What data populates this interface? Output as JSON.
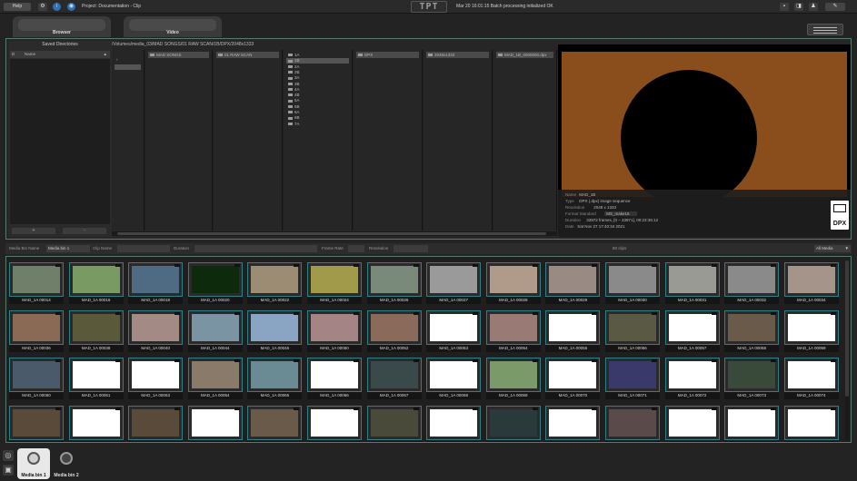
{
  "topbar": {
    "help_label": "Help",
    "project_title": "Project: Documentation - Clip",
    "logo_text": "TPT",
    "status_message": "Mar 20 16:01:15 Batch processing initialized OK"
  },
  "tabs": [
    {
      "label": "Browser"
    },
    {
      "label": "Video"
    }
  ],
  "browser": {
    "saved_title": "Saved Directories",
    "col_number": "D",
    "col_name": "Name",
    "sort_icon": "▲",
    "btn_add": "+",
    "btn_remove": "-",
    "path": "/Volumes/media_03/MAD SONGS/01 RAW SCAN/1B/DPX/2048x1333",
    "columns": [
      {
        "selected": "",
        "items": []
      },
      {
        "selected": "MAD SONGS",
        "items": []
      },
      {
        "selected": "01 RAW SCAN",
        "items": []
      },
      {
        "selected": "",
        "items": [
          "1A",
          "1B",
          "2A",
          "2B",
          "3A",
          "3B",
          "4A",
          "4B",
          "5A",
          "5B",
          "6A",
          "6B",
          "7A"
        ],
        "active_index": 1
      },
      {
        "selected": "DPX",
        "items": []
      },
      {
        "selected": "2048x1333",
        "items": []
      },
      {
        "selected": "MAD_1B_0000000.dpx",
        "items": []
      }
    ]
  },
  "preview_info": {
    "name_k": "Name",
    "name_v": "MAD_1B",
    "type_k": "Type",
    "type_v": "DPX (.dpx) image sequence",
    "res_k": "Resolution",
    "res_v": "2048 x 1333",
    "fmt_k": "Format Standard",
    "fmt_v": "MS_make16",
    "dur_k": "Duration",
    "dur_v": "33972 frames, [0 – 33971], 00:23:35:12",
    "date_k": "Date",
    "date_v": "Sat Nov 27 17:40:34 2021",
    "badge": "DPX"
  },
  "filter": {
    "bin_name_label": "Media Bin Name",
    "bin_name_value": "Media bin 1",
    "clip_name_label": "Clip Name",
    "duration_label": "Duration",
    "frame_rate_label": "Frame Rate",
    "resolution_label": "Resolution",
    "count": "80 clips",
    "media_filter": "All Media",
    "arrow": "▼"
  },
  "clips": [
    {
      "name": "MAD_1A 00014",
      "color": "#6f7f6a"
    },
    {
      "name": "MAD_1A 00016",
      "color": "#7a9a64"
    },
    {
      "name": "MAD_1A 00018",
      "color": "#4f6b84"
    },
    {
      "name": "MAD_1A 00020",
      "color": "#0d2a0d"
    },
    {
      "name": "MAD_1A 00022",
      "color": "#9c8c74"
    },
    {
      "name": "MAD_1A 00024",
      "color": "#a09a4a"
    },
    {
      "name": "MAD_1A 00026",
      "color": "#7a8a7a"
    },
    {
      "name": "MAD_1A 00027",
      "color": "#9a9a9a"
    },
    {
      "name": "MAD_1A 00028",
      "color": "#b09a8a"
    },
    {
      "name": "MAD_1A 00029",
      "color": "#9a8a84"
    },
    {
      "name": "MAD_1A 00030",
      "color": "#8a8a8a"
    },
    {
      "name": "MAD_1A 00031",
      "color": "#9a9a94"
    },
    {
      "name": "MAD_1A 00032",
      "color": "#8a8a8a"
    },
    {
      "name": "MAD_1A 00034",
      "color": "#a4948a"
    },
    {
      "name": "MAD_1A 00036",
      "color": "#8a6a54"
    },
    {
      "name": "MAD_1A 00038",
      "color": "#5a5a3a"
    },
    {
      "name": "MAD_1A 00040",
      "color": "#a48a84"
    },
    {
      "name": "MAD_1A 00044",
      "color": "#7a94a4"
    },
    {
      "name": "MAD_1A 00046",
      "color": "#8aa4c4"
    },
    {
      "name": "MAD_1A 00050",
      "color": "#a48484"
    },
    {
      "name": "MAD_1A 00052",
      "color": "#8a6a5a"
    },
    {
      "name": "MAD_1A 00053",
      "color": "",
      "blank": true
    },
    {
      "name": "MAD_1A 00054",
      "color": "#9a7a74"
    },
    {
      "name": "MAD_1A 00055",
      "color": "",
      "blank": true
    },
    {
      "name": "MAD_1A 00056",
      "color": "#5a5a44"
    },
    {
      "name": "MAD_1A 00057",
      "color": "",
      "blank": true
    },
    {
      "name": "MAD_1A 00058",
      "color": "#6a5a4a"
    },
    {
      "name": "MAD_1A 00059",
      "color": "",
      "blank": true
    },
    {
      "name": "MAD_1A 00060",
      "color": "#4a5a6a"
    },
    {
      "name": "MAD_1A 00061",
      "color": "",
      "blank": true
    },
    {
      "name": "MAD_1A 00063",
      "color": "",
      "blank": true
    },
    {
      "name": "MAD_1A 00064",
      "color": "#8a7a6a"
    },
    {
      "name": "MAD_1A 00065",
      "color": "#6a8a94"
    },
    {
      "name": "MAD_1A 00066",
      "color": "",
      "blank": true
    },
    {
      "name": "MAD_1A 00067",
      "color": "#3a4a4a"
    },
    {
      "name": "MAD_1A 00068",
      "color": "",
      "blank": true
    },
    {
      "name": "MAD_1A 00069",
      "color": "#7a9a6a"
    },
    {
      "name": "MAD_1A 00070",
      "color": "",
      "blank": true
    },
    {
      "name": "MAD_1A 00071",
      "color": "#3a3a6a"
    },
    {
      "name": "MAD_1A 00072",
      "color": "",
      "blank": true
    },
    {
      "name": "MAD_1A 00073",
      "color": "#3a4a3a"
    },
    {
      "name": "MAD_1A 00074",
      "color": "",
      "blank": true
    },
    {
      "name": "MAD_1A 00075",
      "color": "#5a4a3a"
    },
    {
      "name": "MAD_1A 00076",
      "color": "",
      "blank": true
    },
    {
      "name": "MAD_1A 00077",
      "color": "#5a4a3a"
    },
    {
      "name": "MAD_1A 00078",
      "color": "",
      "blank": true
    },
    {
      "name": "MAD_1A 00079",
      "color": "#6a5a4a"
    },
    {
      "name": "MAD_1A 00080",
      "color": "",
      "blank": true
    },
    {
      "name": "MAD_1A 00081",
      "color": "#4a4a3a"
    },
    {
      "name": "MAD_1A 00082",
      "color": "",
      "blank": true
    },
    {
      "name": "MAD_1A 00083",
      "color": "#2a3a3a"
    },
    {
      "name": "MAD_1A 00084",
      "color": "",
      "blank": true
    },
    {
      "name": "MAD_1A 00085",
      "color": "#5a4a4a"
    },
    {
      "name": "MAD_1A 00086",
      "color": "",
      "blank": true
    },
    {
      "name": "MAD_1A 00087",
      "color": "",
      "blank": true
    },
    {
      "name": "MAD_1A 00090",
      "color": "",
      "blank": true
    }
  ],
  "bins": [
    {
      "label": "Media bin 1"
    },
    {
      "label": "Media bin 2"
    }
  ],
  "bottom": {
    "side_top": "◎",
    "side_bottom": "▣"
  }
}
